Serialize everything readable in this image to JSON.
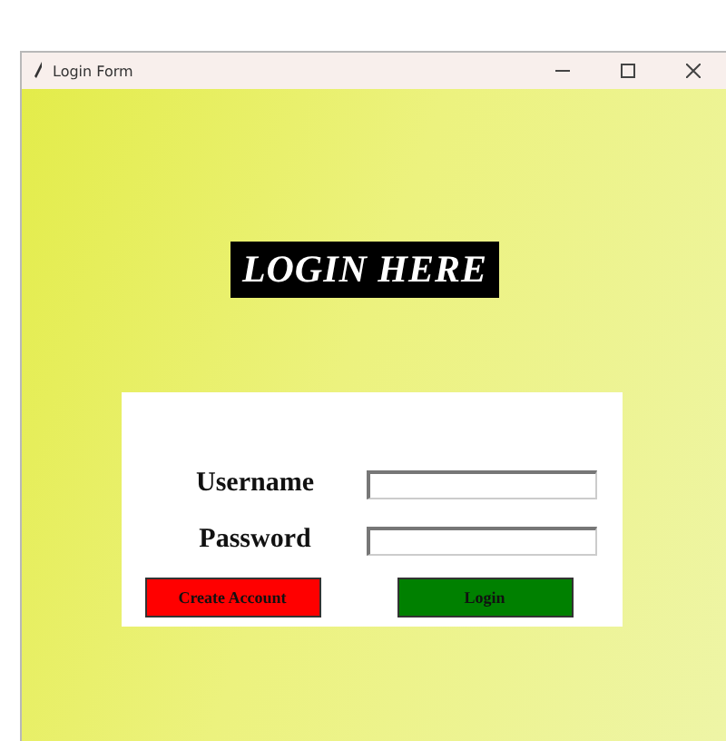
{
  "window": {
    "title": "Login Form"
  },
  "heading": "LOGIN HERE",
  "form": {
    "fields": [
      {
        "label": "Username"
      },
      {
        "label": "Password"
      }
    ],
    "buttons": [
      {
        "label": "Create Account",
        "kind": "danger"
      },
      {
        "label": "Login",
        "kind": "primary"
      }
    ]
  }
}
